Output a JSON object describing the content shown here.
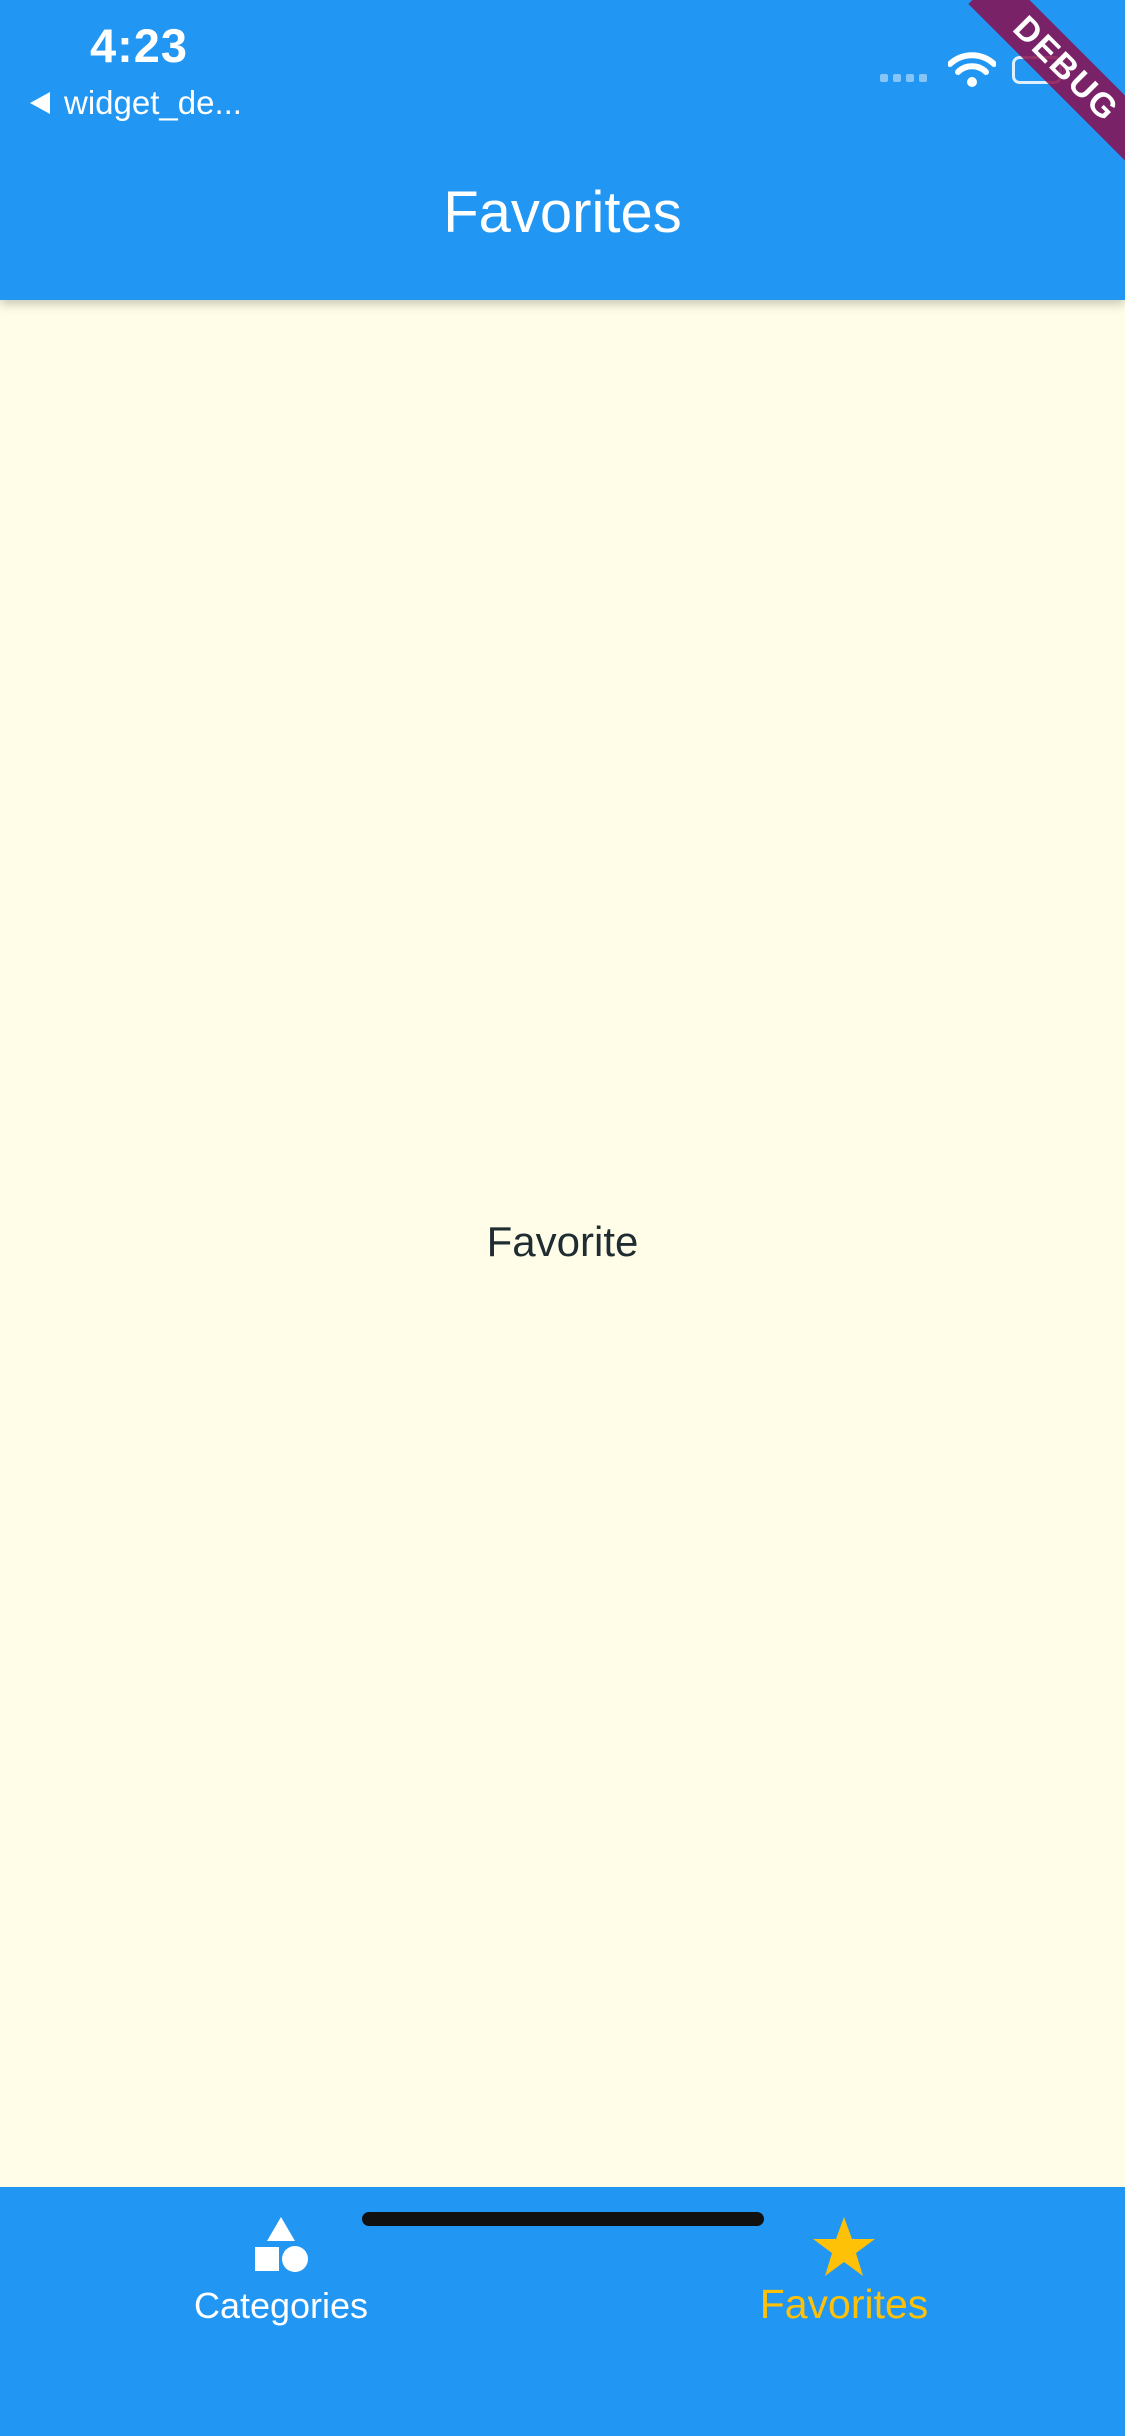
{
  "status_bar": {
    "time": "4:23",
    "back_app_label": "widget_de..."
  },
  "debug_banner": "DEBUG",
  "app_bar": {
    "title": "Favorites"
  },
  "body": {
    "center_text": "Favorite",
    "background_color": "#FFFDE7"
  },
  "bottom_nav": {
    "items": [
      {
        "label": "Categories",
        "icon": "shapes-icon",
        "selected": false
      },
      {
        "label": "Favorites",
        "icon": "star-icon",
        "selected": true
      }
    ],
    "selected_color": "#FFC107",
    "unselected_color": "#FFFFFF"
  },
  "colors": {
    "primary": "#2196F3",
    "accent": "#FFC107",
    "debug": "#880E4F"
  }
}
